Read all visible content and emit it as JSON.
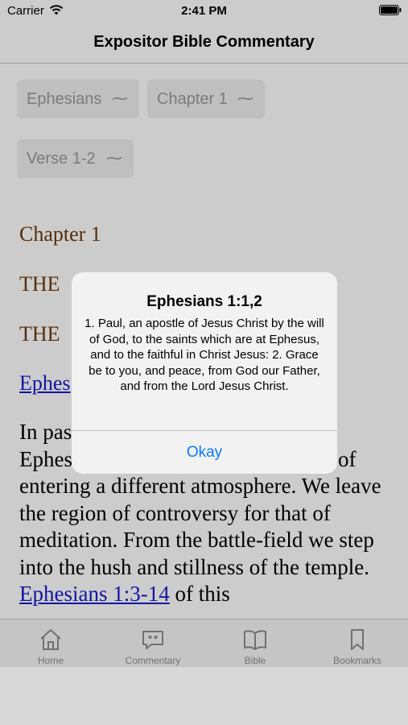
{
  "status_bar": {
    "carrier": "Carrier",
    "time": "2:41 PM",
    "icons": [
      "wifi-icon",
      "battery-icon"
    ]
  },
  "nav": {
    "title": "Expositor Bible Commentary"
  },
  "pickers": {
    "book": "Ephesians",
    "chapter": "Chapter 1",
    "verse": "Verse 1-2",
    "chevron": "⌵"
  },
  "content": {
    "chapter_heading": "Chapter 1",
    "heading_2": "THE",
    "heading_3": "THE",
    "link_1": "Ephes",
    "paragraph": {
      "before_link": "In pas",
      "line_2_a": "Ephes",
      "line_2_b": "of",
      "lines": "entering a different atmosphere. We leave the region of controversy for that of meditation. From the battle-field we step into the hush and stillness of the temple.",
      "link_2": "Ephesians 1:3-14",
      "after_link": " of this"
    },
    "colors": {
      "heading": "#6e3a0b",
      "link": "#1a1acd",
      "accent": "#0a7aff"
    }
  },
  "alert": {
    "title": "Ephesians 1:1,2",
    "message": "1. Paul, an apostle of Jesus Christ by the will of God, to the saints which are at Ephesus, and to the faithful in Christ Jesus: 2. Grace be to you, and peace, from God our Father, and from the Lord Jesus Christ.",
    "button": "Okay"
  },
  "tabs": [
    {
      "label": "Home",
      "icon": "home-icon"
    },
    {
      "label": "Commentary",
      "icon": "quote-bubble-icon"
    },
    {
      "label": "Bible",
      "icon": "book-icon"
    },
    {
      "label": "Bookmarks",
      "icon": "bookmark-icon"
    }
  ]
}
